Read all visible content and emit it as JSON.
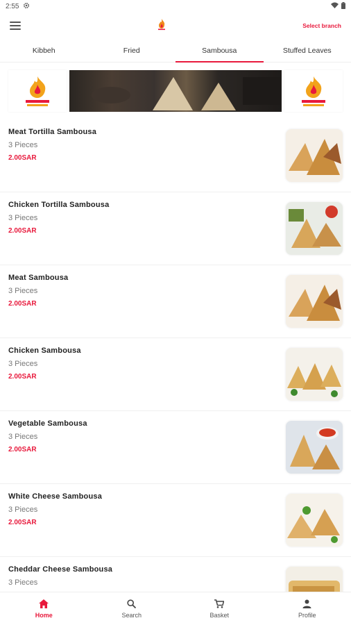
{
  "status_bar": {
    "time": "2:55",
    "gear_icon": "gear-icon",
    "wifi_icon": "wifi-icon",
    "battery_icon": "battery-icon"
  },
  "header": {
    "menu_icon": "menu-icon",
    "logo_icon": "flame-logo-icon",
    "select_branch_label": "Select branch"
  },
  "tabs": [
    {
      "label": "Kibbeh",
      "active": false
    },
    {
      "label": "Fried",
      "active": false
    },
    {
      "label": "Sambousa",
      "active": true
    },
    {
      "label": "Stuffed Leaves",
      "active": false
    }
  ],
  "banner": {
    "logo_left": "restaurant-logo",
    "logo_right": "restaurant-logo"
  },
  "items": [
    {
      "name": "Meat Tortilla Sambousa",
      "pieces": "3 Pieces",
      "price": "2.00SAR"
    },
    {
      "name": "Chicken Tortilla Sambousa",
      "pieces": "3 Pieces",
      "price": "2.00SAR"
    },
    {
      "name": "Meat Sambousa",
      "pieces": "3 Pieces",
      "price": "2.00SAR"
    },
    {
      "name": "Chicken Sambousa",
      "pieces": "3 Pieces",
      "price": "2.00SAR"
    },
    {
      "name": "Vegetable Sambousa",
      "pieces": "3 Pieces",
      "price": "2.00SAR"
    },
    {
      "name": "White Cheese Sambousa",
      "pieces": "3 Pieces",
      "price": "2.00SAR"
    },
    {
      "name": "Cheddar Cheese Sambousa",
      "pieces": "3 Pieces",
      "price": ""
    }
  ],
  "bottom_nav": [
    {
      "label": "Home",
      "icon": "home-icon",
      "active": true
    },
    {
      "label": "Search",
      "icon": "search-icon",
      "active": false
    },
    {
      "label": "Basket",
      "icon": "cart-icon",
      "active": false
    },
    {
      "label": "Profile",
      "icon": "person-icon",
      "active": false
    }
  ],
  "colors": {
    "accent": "#e8193c"
  }
}
